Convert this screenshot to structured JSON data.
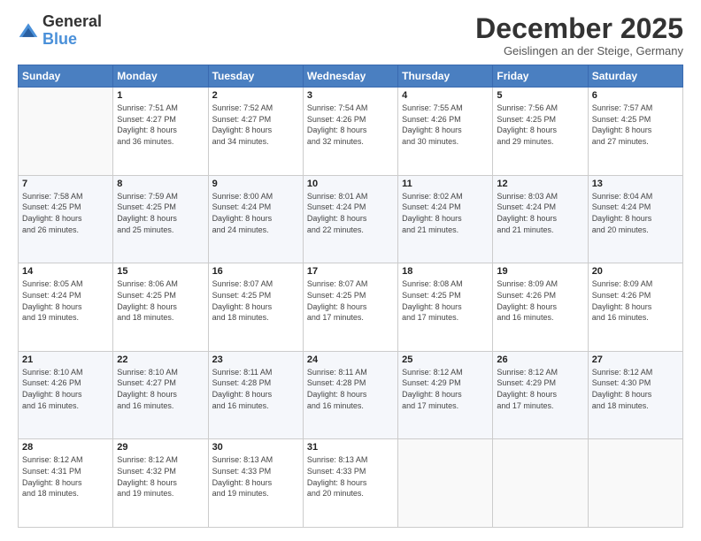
{
  "logo": {
    "general": "General",
    "blue": "Blue"
  },
  "header": {
    "month": "December 2025",
    "location": "Geislingen an der Steige, Germany"
  },
  "days_of_week": [
    "Sunday",
    "Monday",
    "Tuesday",
    "Wednesday",
    "Thursday",
    "Friday",
    "Saturday"
  ],
  "weeks": [
    [
      {
        "day": "",
        "info": ""
      },
      {
        "day": "1",
        "info": "Sunrise: 7:51 AM\nSunset: 4:27 PM\nDaylight: 8 hours\nand 36 minutes."
      },
      {
        "day": "2",
        "info": "Sunrise: 7:52 AM\nSunset: 4:27 PM\nDaylight: 8 hours\nand 34 minutes."
      },
      {
        "day": "3",
        "info": "Sunrise: 7:54 AM\nSunset: 4:26 PM\nDaylight: 8 hours\nand 32 minutes."
      },
      {
        "day": "4",
        "info": "Sunrise: 7:55 AM\nSunset: 4:26 PM\nDaylight: 8 hours\nand 30 minutes."
      },
      {
        "day": "5",
        "info": "Sunrise: 7:56 AM\nSunset: 4:25 PM\nDaylight: 8 hours\nand 29 minutes."
      },
      {
        "day": "6",
        "info": "Sunrise: 7:57 AM\nSunset: 4:25 PM\nDaylight: 8 hours\nand 27 minutes."
      }
    ],
    [
      {
        "day": "7",
        "info": "Sunrise: 7:58 AM\nSunset: 4:25 PM\nDaylight: 8 hours\nand 26 minutes."
      },
      {
        "day": "8",
        "info": "Sunrise: 7:59 AM\nSunset: 4:25 PM\nDaylight: 8 hours\nand 25 minutes."
      },
      {
        "day": "9",
        "info": "Sunrise: 8:00 AM\nSunset: 4:24 PM\nDaylight: 8 hours\nand 24 minutes."
      },
      {
        "day": "10",
        "info": "Sunrise: 8:01 AM\nSunset: 4:24 PM\nDaylight: 8 hours\nand 22 minutes."
      },
      {
        "day": "11",
        "info": "Sunrise: 8:02 AM\nSunset: 4:24 PM\nDaylight: 8 hours\nand 21 minutes."
      },
      {
        "day": "12",
        "info": "Sunrise: 8:03 AM\nSunset: 4:24 PM\nDaylight: 8 hours\nand 21 minutes."
      },
      {
        "day": "13",
        "info": "Sunrise: 8:04 AM\nSunset: 4:24 PM\nDaylight: 8 hours\nand 20 minutes."
      }
    ],
    [
      {
        "day": "14",
        "info": "Sunrise: 8:05 AM\nSunset: 4:24 PM\nDaylight: 8 hours\nand 19 minutes."
      },
      {
        "day": "15",
        "info": "Sunrise: 8:06 AM\nSunset: 4:25 PM\nDaylight: 8 hours\nand 18 minutes."
      },
      {
        "day": "16",
        "info": "Sunrise: 8:07 AM\nSunset: 4:25 PM\nDaylight: 8 hours\nand 18 minutes."
      },
      {
        "day": "17",
        "info": "Sunrise: 8:07 AM\nSunset: 4:25 PM\nDaylight: 8 hours\nand 17 minutes."
      },
      {
        "day": "18",
        "info": "Sunrise: 8:08 AM\nSunset: 4:25 PM\nDaylight: 8 hours\nand 17 minutes."
      },
      {
        "day": "19",
        "info": "Sunrise: 8:09 AM\nSunset: 4:26 PM\nDaylight: 8 hours\nand 16 minutes."
      },
      {
        "day": "20",
        "info": "Sunrise: 8:09 AM\nSunset: 4:26 PM\nDaylight: 8 hours\nand 16 minutes."
      }
    ],
    [
      {
        "day": "21",
        "info": "Sunrise: 8:10 AM\nSunset: 4:26 PM\nDaylight: 8 hours\nand 16 minutes."
      },
      {
        "day": "22",
        "info": "Sunrise: 8:10 AM\nSunset: 4:27 PM\nDaylight: 8 hours\nand 16 minutes."
      },
      {
        "day": "23",
        "info": "Sunrise: 8:11 AM\nSunset: 4:28 PM\nDaylight: 8 hours\nand 16 minutes."
      },
      {
        "day": "24",
        "info": "Sunrise: 8:11 AM\nSunset: 4:28 PM\nDaylight: 8 hours\nand 16 minutes."
      },
      {
        "day": "25",
        "info": "Sunrise: 8:12 AM\nSunset: 4:29 PM\nDaylight: 8 hours\nand 17 minutes."
      },
      {
        "day": "26",
        "info": "Sunrise: 8:12 AM\nSunset: 4:29 PM\nDaylight: 8 hours\nand 17 minutes."
      },
      {
        "day": "27",
        "info": "Sunrise: 8:12 AM\nSunset: 4:30 PM\nDaylight: 8 hours\nand 18 minutes."
      }
    ],
    [
      {
        "day": "28",
        "info": "Sunrise: 8:12 AM\nSunset: 4:31 PM\nDaylight: 8 hours\nand 18 minutes."
      },
      {
        "day": "29",
        "info": "Sunrise: 8:12 AM\nSunset: 4:32 PM\nDaylight: 8 hours\nand 19 minutes."
      },
      {
        "day": "30",
        "info": "Sunrise: 8:13 AM\nSunset: 4:33 PM\nDaylight: 8 hours\nand 19 minutes."
      },
      {
        "day": "31",
        "info": "Sunrise: 8:13 AM\nSunset: 4:33 PM\nDaylight: 8 hours\nand 20 minutes."
      },
      {
        "day": "",
        "info": ""
      },
      {
        "day": "",
        "info": ""
      },
      {
        "day": "",
        "info": ""
      }
    ]
  ]
}
